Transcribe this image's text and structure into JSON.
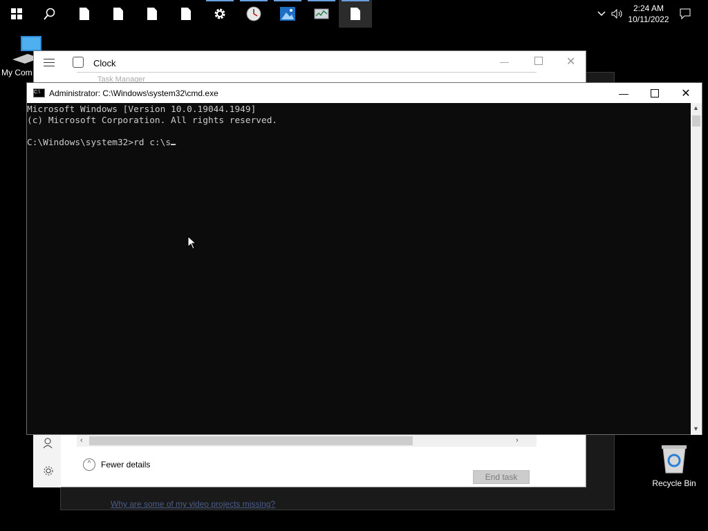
{
  "taskbar": {
    "clock_time": "2:24 AM",
    "clock_date": "10/11/2022"
  },
  "desktop": {
    "my_computer_label": "My Com",
    "recycle_bin_label": "Recycle Bin"
  },
  "clock_window": {
    "title": "Clock"
  },
  "task_manager": {
    "title": "Task Manager",
    "fewer_details": "Fewer details",
    "end_task": "End task"
  },
  "video_app": {
    "link_text": "Why are some of my video projects missing?"
  },
  "cmd": {
    "title": "Administrator: C:\\Windows\\system32\\cmd.exe",
    "line1": "Microsoft Windows [Version 10.0.19044.1949]",
    "line2": "(c) Microsoft Corporation. All rights reserved.",
    "prompt": "C:\\Windows\\system32>",
    "command": "rd c:\\s"
  },
  "colors": {
    "taskbar_bg": "#000000",
    "cmd_bg": "#0c0c0c",
    "cmd_text": "#cccccc",
    "running_indicator": "#6a9fe0"
  }
}
